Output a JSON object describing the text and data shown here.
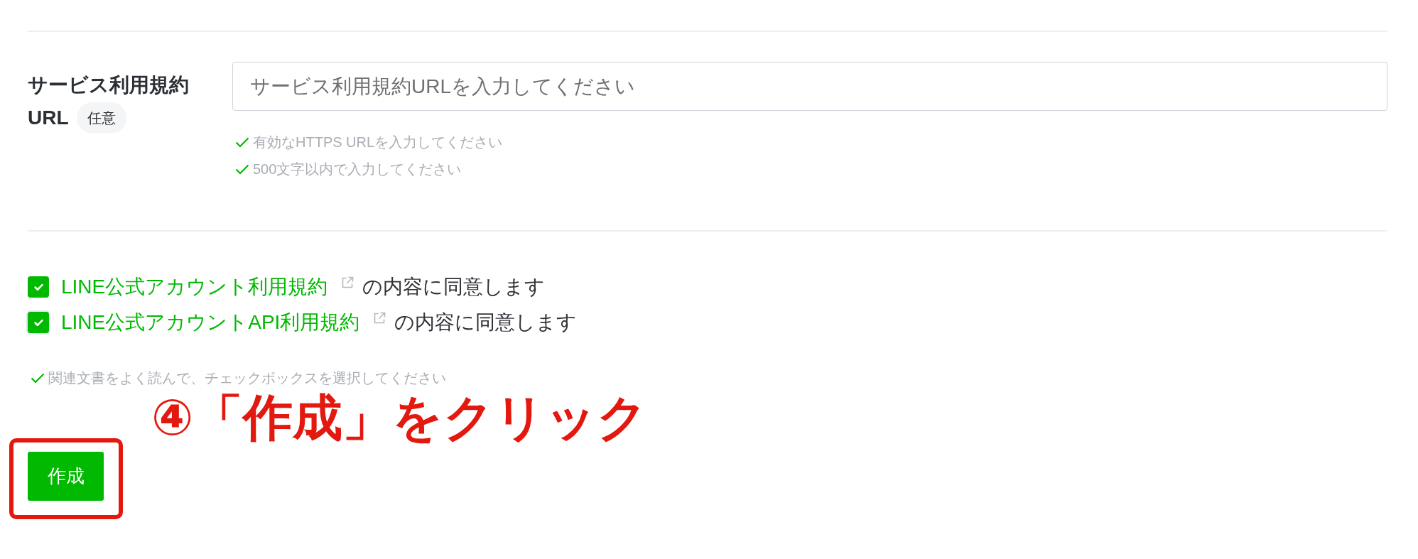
{
  "url_field": {
    "label_lines": [
      "サービス利用規約",
      "URL"
    ],
    "badge": "任意",
    "placeholder": "サービス利用規約URLを入力してください",
    "hints": [
      "有効なHTTPS URLを入力してください",
      "500文字以内で入力してください"
    ]
  },
  "agreements": [
    {
      "link": "LINE公式アカウント利用規約",
      "text": "の内容に同意します",
      "checked": true,
      "focused": false
    },
    {
      "link": "LINE公式アカウントAPI利用規約",
      "text": "の内容に同意します",
      "checked": true,
      "focused": true
    }
  ],
  "agreement_hint": "関連文書をよく読んで、チェックボックスを選択してください",
  "annotation": {
    "text": "④「作成」をクリック"
  },
  "submit_button": {
    "label": "作成",
    "highlighted": true
  }
}
